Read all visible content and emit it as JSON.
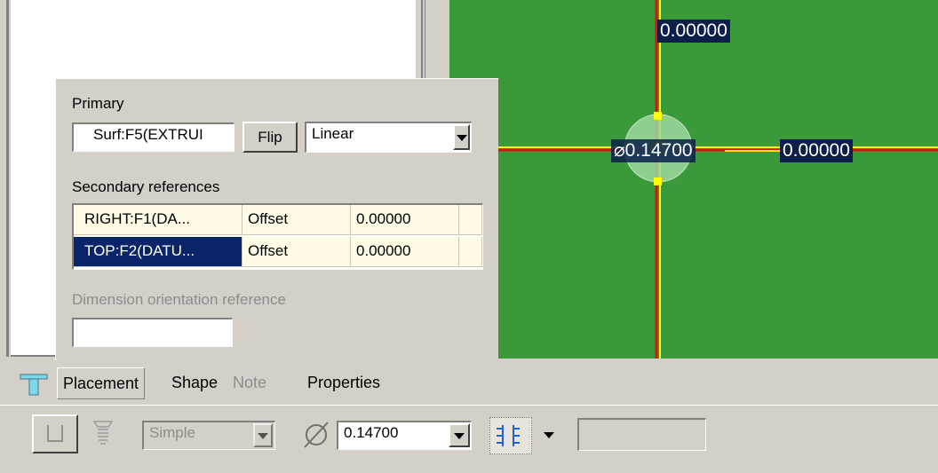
{
  "canvas": {
    "dim_top": "0.00000",
    "dim_right": "0.00000",
    "dim_diameter": "⌀0.14700"
  },
  "placement": {
    "primary_label": "Primary",
    "primary_value": "Surf:F5(EXTRUI",
    "flip_label": "Flip",
    "placement_type": "Linear",
    "secondary_label": "Secondary references",
    "secondary_rows": [
      {
        "ref": "RIGHT:F1(DA...",
        "type": "Offset",
        "value": "0.00000"
      },
      {
        "ref": "TOP:F2(DATU...",
        "type": "Offset",
        "value": "0.00000"
      }
    ],
    "dim_orient_label": "Dimension orientation reference",
    "dim_orient_value": ""
  },
  "tabs": {
    "placement": "Placement",
    "shape": "Shape",
    "note": "Note",
    "properties": "Properties"
  },
  "toolbar": {
    "hole_type": "Simple",
    "diameter_value": "0.14700",
    "depth_value": ""
  },
  "colors": {
    "canvas_bg": "#3a9a3a",
    "axis_yellow": "#ffff00",
    "axis_red": "#e01010",
    "selection": "#0a246a"
  }
}
